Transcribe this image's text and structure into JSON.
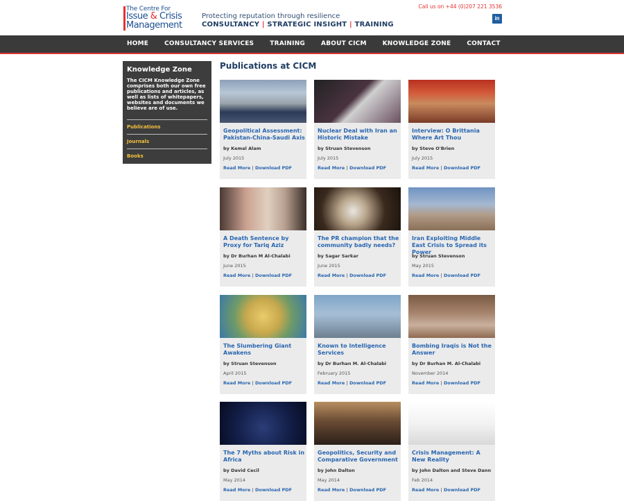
{
  "header": {
    "logo_line1": "The Centre For",
    "logo_line2a": "Issue ",
    "logo_line2b": "&",
    "logo_line2c": " Crisis",
    "logo_line3": "Management",
    "tagline": "Protecting reputation through resilience",
    "services": [
      "CONSULTANCY",
      "STRATEGIC INSIGHT",
      "TRAINING"
    ],
    "service_separator": "|",
    "call_us": "Call us on +44 (0)207 221 3536",
    "linkedin_label": "in"
  },
  "nav": {
    "items": [
      "HOME",
      "CONSULTANCY SERVICES",
      "TRAINING",
      "ABOUT CICM",
      "KNOWLEDGE ZONE",
      "CONTACT"
    ]
  },
  "sidebar": {
    "title": "Knowledge Zone",
    "description": "The CICM Knowledge Zone comprises both our own free publications and articles, as well as lists of whitepapers, websites and documents we believe are of use.",
    "links": [
      "Publications",
      "Journals",
      "Books"
    ]
  },
  "main": {
    "title": "Publications at CICM",
    "read_more_label": "Read More",
    "download_label": "Download PDF",
    "link_separator": "|",
    "cards": [
      {
        "title": "Geopolitical Assessment: Pakistan-China-Saudi Axis",
        "author": "by Kemal Alam",
        "date": "July 2015",
        "thumb": "military-delegation-photo"
      },
      {
        "title": "Nuclear Deal with Iran an Historic Mistake",
        "author": "by Struan Stevenson",
        "date": "July 2015",
        "thumb": "handshake-photo"
      },
      {
        "title": "Interview: O Brittania Where Art Thou",
        "author": "by Steve O'Brien",
        "date": "July 2015",
        "thumb": "portrait-photo"
      },
      {
        "title": "A Death Sentence by Proxy for Tariq Aziz",
        "author": "by Dr Burhan M Al-Chalabi",
        "date": "June 2015",
        "thumb": "portrait-photo"
      },
      {
        "title": "The PR champion that the community badly needs?",
        "author": "by Sagar Sarkar",
        "date": "June 2015",
        "thumb": "speaker-photo"
      },
      {
        "title": "Iran Exploiting Middle East Crisis to Spread its Power",
        "author": "by Struan Stevenson",
        "date": "May 2015",
        "thumb": "rifle-landscape-photo"
      },
      {
        "title": "The Slumbering Giant Awakens",
        "author": "by Struan Stevenson",
        "date": "April 2015",
        "thumb": "map-photo"
      },
      {
        "title": "Known to Intelligence Services",
        "author": "by Dr Burhan M. Al-Chalabi",
        "date": "February 2015",
        "thumb": "cctv-camera-photo"
      },
      {
        "title": "Bombing Iraqis is Not the Answer",
        "author": "by Dr Burhan M. Al-Chalabi",
        "date": "November 2014",
        "thumb": "ruins-photo"
      },
      {
        "title": "The 7 Myths about Risk in Africa",
        "author": "by David Cecil",
        "date": "May 2014",
        "thumb": "night-earth-photo"
      },
      {
        "title": "Geopolitics, Security and Comparative Government",
        "author": "by John Dalton",
        "date": "May 2014",
        "thumb": "chess-pieces-photo"
      },
      {
        "title": "Crisis Management: A New Reality",
        "author": "by John Dalton and Steve Dann",
        "date": "Feb 2014",
        "thumb": "red-arrow-crack-image"
      }
    ]
  }
}
